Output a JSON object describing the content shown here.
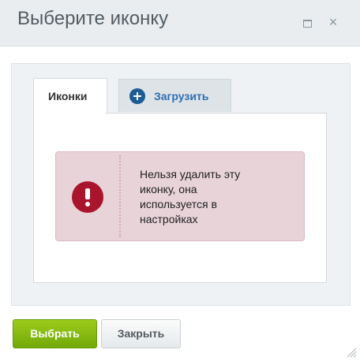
{
  "dialog": {
    "title": "Выберите иконку",
    "maximize_icon": "maximize-icon",
    "close_icon": "close-icon"
  },
  "tabs": [
    {
      "label": "Иконки",
      "active": true
    },
    {
      "label": "Загрузить",
      "active": false,
      "icon": "plus-circle-icon"
    }
  ],
  "alert": {
    "icon": "exclamation-icon",
    "message": "Нельзя удалить эту\nиконку, она\nиспользуется в\nнастройках"
  },
  "buttons": {
    "select_label": "Выбрать",
    "close_label": "Закрыть"
  },
  "colors": {
    "primary_button": "#7ab30d",
    "alert_bg": "#e8d3d9",
    "alert_icon": "#a8152c",
    "link_blue": "#2f6fb4"
  }
}
